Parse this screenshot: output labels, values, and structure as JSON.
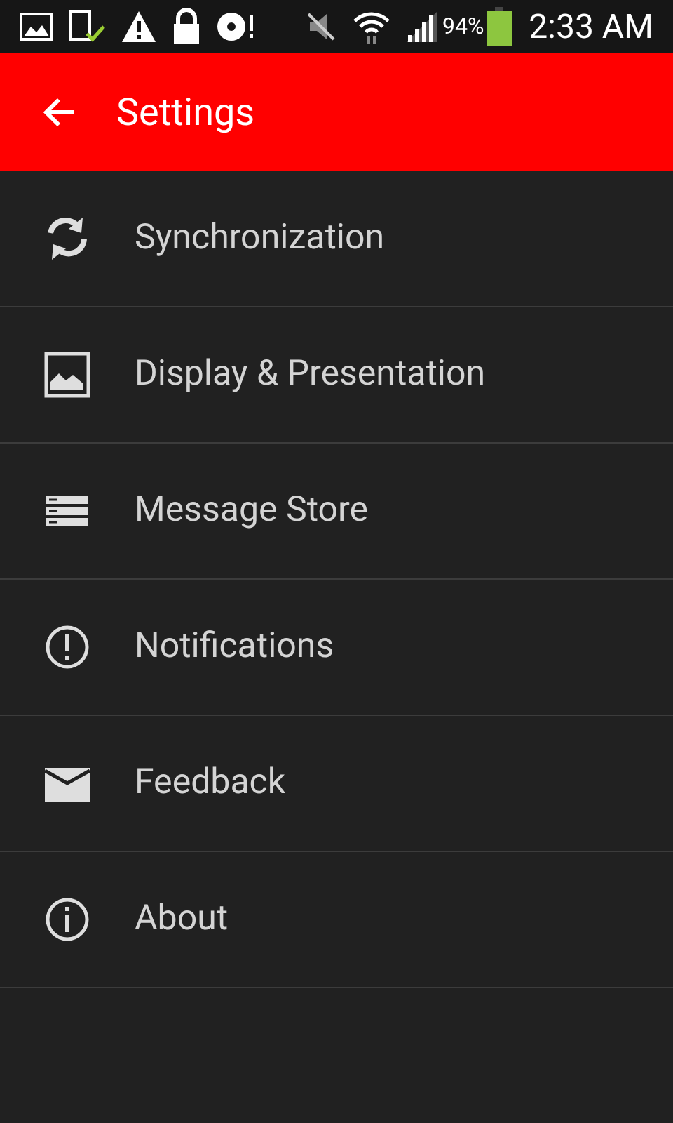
{
  "status_bar": {
    "battery": "94%",
    "time": "2:33 AM"
  },
  "app_bar": {
    "title": "Settings"
  },
  "items": [
    {
      "label": "Synchronization",
      "kind": "sync"
    },
    {
      "label": "Display & Presentation",
      "kind": "display"
    },
    {
      "label": "Message Store",
      "kind": "store"
    },
    {
      "label": "Notifications",
      "kind": "notifications"
    },
    {
      "label": "Feedback",
      "kind": "feedback"
    },
    {
      "label": "About",
      "kind": "about"
    }
  ]
}
